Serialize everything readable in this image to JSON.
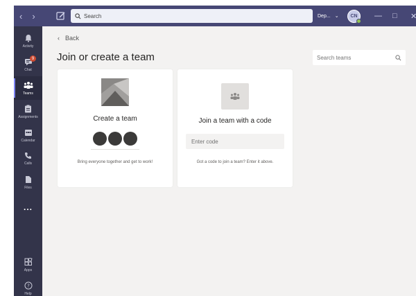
{
  "titlebar": {
    "search_placeholder": "Search",
    "org_name": "Dep...",
    "avatar_initials": "CN"
  },
  "rail": {
    "items": [
      {
        "label": "Activity",
        "icon": "bell-icon"
      },
      {
        "label": "Chat",
        "icon": "chat-icon",
        "badge": "9"
      },
      {
        "label": "Teams",
        "icon": "teams-icon",
        "active": true
      },
      {
        "label": "Assignments",
        "icon": "assignments-icon"
      },
      {
        "label": "Calendar",
        "icon": "calendar-icon"
      },
      {
        "label": "Calls",
        "icon": "phone-icon"
      },
      {
        "label": "Files",
        "icon": "file-icon"
      },
      {
        "label": "...",
        "icon": "more-icon"
      }
    ],
    "bottom": [
      {
        "label": "Apps",
        "icon": "apps-icon"
      },
      {
        "label": "Help",
        "icon": "help-icon"
      }
    ]
  },
  "content": {
    "back_label": "Back",
    "title": "Join or create a team",
    "search_placeholder": "Search teams",
    "create_card": {
      "title": "Create a team",
      "hint": "Bring everyone together and get to work!"
    },
    "join_card": {
      "title": "Join a team with a code",
      "code_placeholder": "Enter code",
      "hint": "Got a code to join a team? Enter it above."
    }
  },
  "colors": {
    "titlebar": "#464775",
    "rail": "#33344a",
    "accent": "#7f85f5",
    "badge": "#cc4a31",
    "background": "#f3f2f1"
  }
}
